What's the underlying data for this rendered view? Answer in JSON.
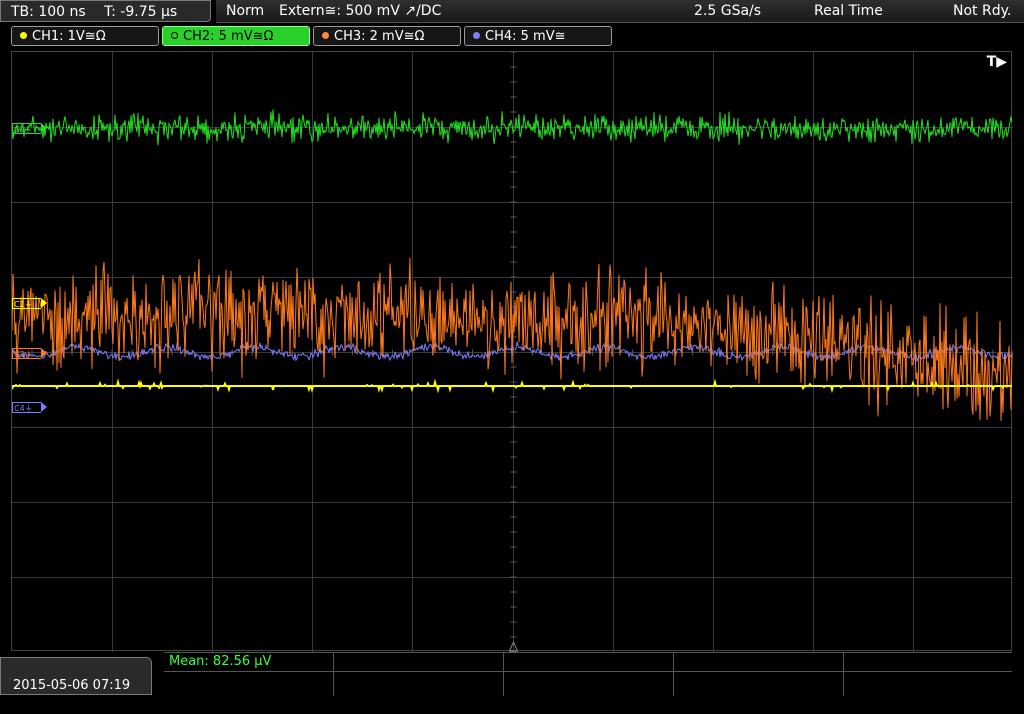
{
  "timebase": {
    "tb": "TB: 100 ns",
    "t": "T: -9.75 µs"
  },
  "status": {
    "mode": "Norm",
    "trigger": "Extern≅: 500 mV ↗/DC",
    "sample_rate": "2.5 GSa/s",
    "acq": "Real Time",
    "state": "Not Rdy."
  },
  "channels": [
    {
      "label": "CH1: 1V≅Ω",
      "color": "#ffff00",
      "active": false
    },
    {
      "label": "CH2: 5 mV≅Ω",
      "color": "#00e000",
      "active": true
    },
    {
      "label": "CH3: 2 mV≅Ω",
      "color": "#ff8a3c",
      "active": false
    },
    {
      "label": "CH4: 5 mV≅",
      "color": "#8080ff",
      "active": false
    }
  ],
  "markers": {
    "c1": "C1⏚",
    "c2": "C2⏚",
    "c3": "C3⏚",
    "c4": "C4⏚"
  },
  "trigger_marker": "T▶",
  "datetime": "2015-05-06 07:19",
  "measurement": {
    "mean": "Mean: 82.56 µV"
  },
  "colors": {
    "ch1": "#ffff00",
    "ch2": "#20e020",
    "ch3": "#ff7a1a",
    "ch4": "#7c7cff",
    "grid": "#3a3a3a"
  }
}
